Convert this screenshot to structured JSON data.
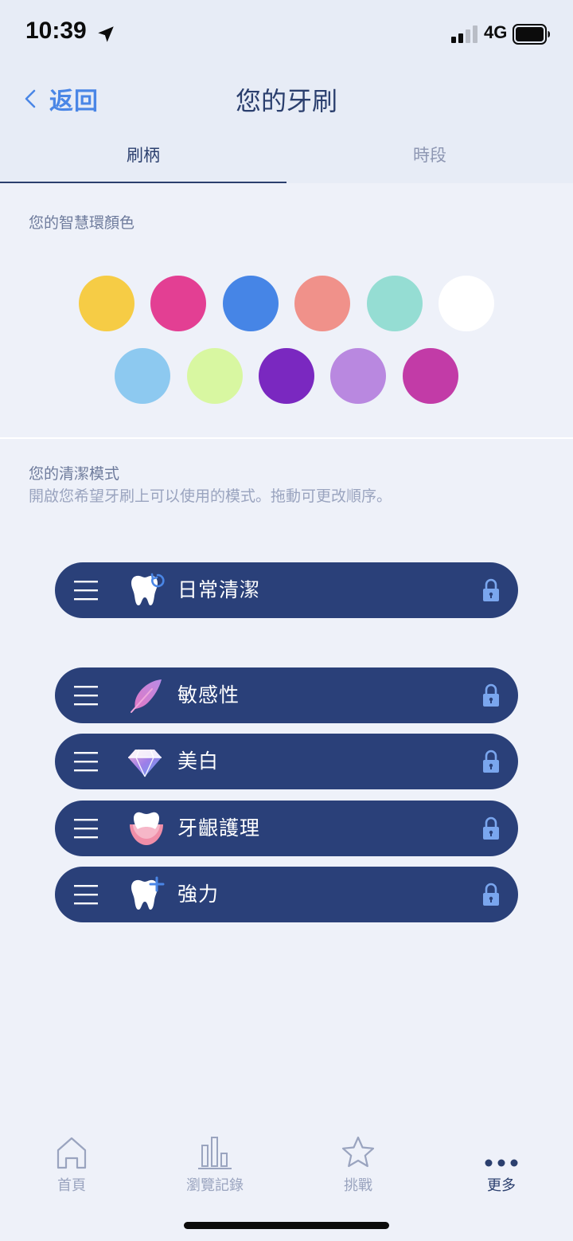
{
  "status_bar": {
    "time": "10:39",
    "network": "4G"
  },
  "nav": {
    "back_label": "返回",
    "title": "您的牙刷"
  },
  "tabs": [
    {
      "label": "刷柄",
      "active": true
    },
    {
      "label": "時段",
      "active": false
    }
  ],
  "ring_color_section": {
    "label": "您的智慧環顏色",
    "colors": [
      "#f6cc45",
      "#e33f93",
      "#4685e6",
      "#f0918a",
      "#95ddd3",
      "#ffffff",
      "#8dc9f0",
      "#d8f7a1",
      "#7a28c0",
      "#b988e0",
      "#c23ba7"
    ]
  },
  "cleaning_section": {
    "label": "您的清潔模式",
    "description": "開啟您希望牙刷上可以使用的模式。拖動可更改順序。"
  },
  "modes": [
    {
      "label": "日常清潔",
      "icon": "tooth-refresh-icon"
    },
    {
      "label": "敏感性",
      "icon": "feather-icon"
    },
    {
      "label": "美白",
      "icon": "diamond-icon"
    },
    {
      "label": "牙齦護理",
      "icon": "gum-care-icon"
    },
    {
      "label": "強力",
      "icon": "tooth-plus-icon"
    }
  ],
  "bottom_nav": [
    {
      "label": "首頁",
      "icon": "home-icon",
      "active": false
    },
    {
      "label": "瀏覽記錄",
      "icon": "bar-chart-icon",
      "active": false
    },
    {
      "label": "挑戰",
      "icon": "star-icon",
      "active": false
    },
    {
      "label": "更多",
      "icon": "more-icon",
      "active": true
    }
  ],
  "colors": {
    "accent": "#4a86e6",
    "primary": "#2b3f6e",
    "pill": "#2a4079",
    "background": "#eef1f9"
  }
}
